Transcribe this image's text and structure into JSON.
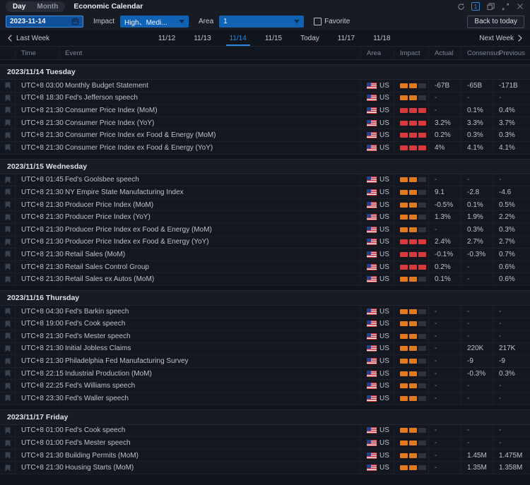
{
  "titlebar": {
    "tabs": [
      {
        "label": "Day",
        "active": true
      },
      {
        "label": "Month",
        "active": false
      }
    ],
    "title": "Economic Calendar",
    "window_badge": "1"
  },
  "filterbar": {
    "date_value": "2023-11-14",
    "impact_label": "Impact",
    "impact_value": "High、Medi...",
    "area_label": "Area",
    "area_value": "1",
    "favorite_label": "Favorite",
    "back_to_today_label": "Back to today"
  },
  "weeknav": {
    "last_week_label": "Last Week",
    "next_week_label": "Next Week",
    "days": [
      {
        "label": "11/12",
        "active": false
      },
      {
        "label": "11/13",
        "active": false
      },
      {
        "label": "11/14",
        "active": true
      },
      {
        "label": "11/15",
        "active": false
      },
      {
        "label": "Today",
        "active": false
      },
      {
        "label": "11/17",
        "active": false
      },
      {
        "label": "11/18",
        "active": false
      }
    ]
  },
  "table": {
    "columns": [
      "Time",
      "Event",
      "Area",
      "Impact",
      "Actual",
      "Consensus",
      "Previous"
    ],
    "sections": [
      {
        "date": "2023/11/14 Tuesday",
        "rows": [
          {
            "time": "UTC+8 03:00",
            "event": "Monthly Budget Statement",
            "area": "US",
            "impact": "medium",
            "actual": "-67B",
            "consensus": "-65B",
            "previous": "-171B"
          },
          {
            "time": "UTC+8 18:30",
            "event": "Fed's Jefferson speech",
            "area": "US",
            "impact": "medium",
            "actual": "-",
            "consensus": "-",
            "previous": "-"
          },
          {
            "time": "UTC+8 21:30",
            "event": "Consumer Price Index (MoM)",
            "area": "US",
            "impact": "high",
            "actual": "-",
            "consensus": "0.1%",
            "previous": "0.4%"
          },
          {
            "time": "UTC+8 21:30",
            "event": "Consumer Price Index (YoY)",
            "area": "US",
            "impact": "high",
            "actual": "3.2%",
            "consensus": "3.3%",
            "previous": "3.7%"
          },
          {
            "time": "UTC+8 21:30",
            "event": "Consumer Price Index ex Food & Energy (MoM)",
            "area": "US",
            "impact": "high",
            "actual": "0.2%",
            "consensus": "0.3%",
            "previous": "0.3%"
          },
          {
            "time": "UTC+8 21:30",
            "event": "Consumer Price Index ex Food & Energy (YoY)",
            "area": "US",
            "impact": "high",
            "actual": "4%",
            "consensus": "4.1%",
            "previous": "4.1%"
          }
        ]
      },
      {
        "date": "2023/11/15 Wednesday",
        "rows": [
          {
            "time": "UTC+8 01:45",
            "event": "Fed's Goolsbee speech",
            "area": "US",
            "impact": "medium",
            "actual": "-",
            "consensus": "-",
            "previous": "-"
          },
          {
            "time": "UTC+8 21:30",
            "event": "NY Empire State Manufacturing Index",
            "area": "US",
            "impact": "medium",
            "actual": "9.1",
            "consensus": "-2.8",
            "previous": "-4.6"
          },
          {
            "time": "UTC+8 21:30",
            "event": "Producer Price Index (MoM)",
            "area": "US",
            "impact": "medium",
            "actual": "-0.5%",
            "consensus": "0.1%",
            "previous": "0.5%"
          },
          {
            "time": "UTC+8 21:30",
            "event": "Producer Price Index (YoY)",
            "area": "US",
            "impact": "medium",
            "actual": "1.3%",
            "consensus": "1.9%",
            "previous": "2.2%"
          },
          {
            "time": "UTC+8 21:30",
            "event": "Producer Price Index ex Food & Energy (MoM)",
            "area": "US",
            "impact": "medium",
            "actual": "-",
            "consensus": "0.3%",
            "previous": "0.3%"
          },
          {
            "time": "UTC+8 21:30",
            "event": "Producer Price Index ex Food & Energy (YoY)",
            "area": "US",
            "impact": "high",
            "actual": "2.4%",
            "consensus": "2.7%",
            "previous": "2.7%"
          },
          {
            "time": "UTC+8 21:30",
            "event": "Retail Sales (MoM)",
            "area": "US",
            "impact": "high",
            "actual": "-0.1%",
            "consensus": "-0.3%",
            "previous": "0.7%"
          },
          {
            "time": "UTC+8 21:30",
            "event": "Retail Sales Control Group",
            "area": "US",
            "impact": "high",
            "actual": "0.2%",
            "consensus": "-",
            "previous": "0.6%"
          },
          {
            "time": "UTC+8 21:30",
            "event": "Retail Sales ex Autos (MoM)",
            "area": "US",
            "impact": "medium",
            "actual": "0.1%",
            "consensus": "-",
            "previous": "0.6%"
          }
        ]
      },
      {
        "date": "2023/11/16 Thursday",
        "rows": [
          {
            "time": "UTC+8 04:30",
            "event": "Fed's Barkin speech",
            "area": "US",
            "impact": "medium",
            "actual": "-",
            "consensus": "-",
            "previous": "-"
          },
          {
            "time": "UTC+8 19:00",
            "event": "Fed's Cook speech",
            "area": "US",
            "impact": "medium",
            "actual": "-",
            "consensus": "-",
            "previous": "-"
          },
          {
            "time": "UTC+8 21:30",
            "event": "Fed's Mester speech",
            "area": "US",
            "impact": "medium",
            "actual": "-",
            "consensus": "-",
            "previous": "-"
          },
          {
            "time": "UTC+8 21:30",
            "event": "Initial Jobless Claims",
            "area": "US",
            "impact": "medium",
            "actual": "-",
            "consensus": "220K",
            "previous": "217K"
          },
          {
            "time": "UTC+8 21:30",
            "event": "Philadelphia Fed Manufacturing Survey",
            "area": "US",
            "impact": "medium",
            "actual": "-",
            "consensus": "-9",
            "previous": "-9"
          },
          {
            "time": "UTC+8 22:15",
            "event": "Industrial Production (MoM)",
            "area": "US",
            "impact": "medium",
            "actual": "-",
            "consensus": "-0.3%",
            "previous": "0.3%"
          },
          {
            "time": "UTC+8 22:25",
            "event": "Fed's Williams speech",
            "area": "US",
            "impact": "medium",
            "actual": "-",
            "consensus": "-",
            "previous": "-"
          },
          {
            "time": "UTC+8 23:30",
            "event": "Fed's Waller speech",
            "area": "US",
            "impact": "medium",
            "actual": "-",
            "consensus": "-",
            "previous": "-"
          }
        ]
      },
      {
        "date": "2023/11/17 Friday",
        "rows": [
          {
            "time": "UTC+8 01:00",
            "event": "Fed's Cook speech",
            "area": "US",
            "impact": "medium",
            "actual": "-",
            "consensus": "-",
            "previous": "-"
          },
          {
            "time": "UTC+8 01:00",
            "event": "Fed's Mester speech",
            "area": "US",
            "impact": "medium",
            "actual": "-",
            "consensus": "-",
            "previous": "-"
          },
          {
            "time": "UTC+8 21:30",
            "event": "Building Permits (MoM)",
            "area": "US",
            "impact": "medium",
            "actual": "-",
            "consensus": "1.45M",
            "previous": "1.475M"
          },
          {
            "time": "UTC+8 21:30",
            "event": "Housing Starts (MoM)",
            "area": "US",
            "impact": "medium",
            "actual": "-",
            "consensus": "1.35M",
            "previous": "1.358M"
          }
        ]
      }
    ]
  },
  "colors": {
    "accent": "#2d87dd",
    "impact_high": "#d53b3e",
    "impact_medium": "#e1791f",
    "impact_off": "#2e333c"
  }
}
